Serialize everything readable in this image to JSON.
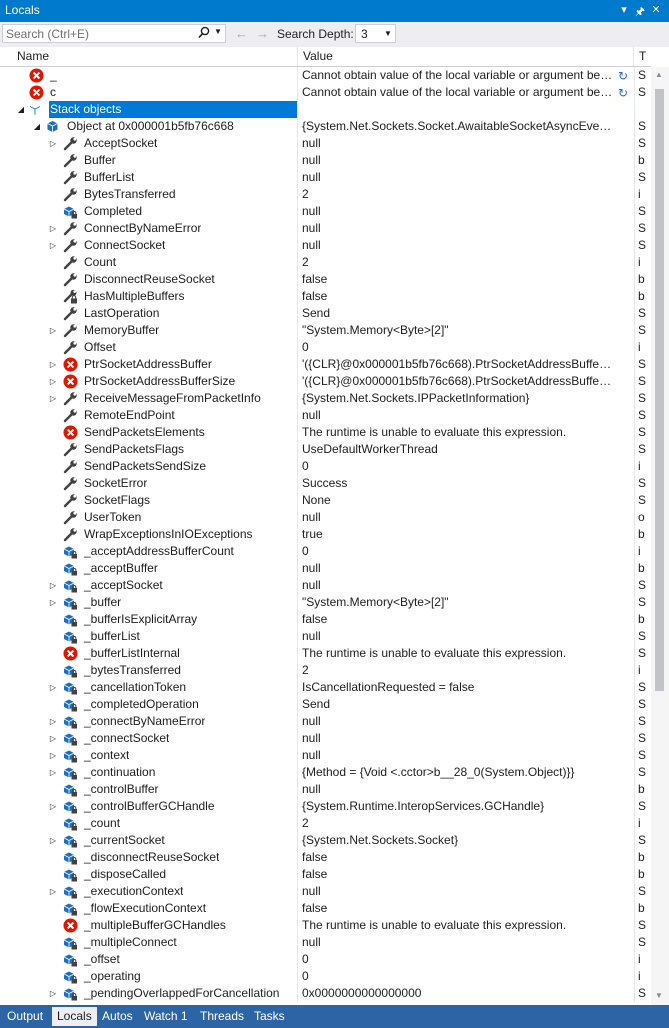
{
  "window": {
    "title": "Locals"
  },
  "toolbar": {
    "search_placeholder": "Search (Ctrl+E)",
    "search_depth_label": "Search Depth:",
    "search_depth_value": "3"
  },
  "columns": {
    "name": "Name",
    "value": "Value",
    "type": "T"
  },
  "rows": [
    {
      "name": "_",
      "value": "Cannot obtain value of the local variable or argument bec...",
      "type": "S",
      "icon": "error",
      "level": 1,
      "expander": "none",
      "refresh": true
    },
    {
      "name": "c",
      "value": "Cannot obtain value of the local variable or argument bec...",
      "type": "S",
      "icon": "error",
      "level": 1,
      "expander": "none",
      "refresh": true
    },
    {
      "name": "Stack objects",
      "value": "",
      "type": "",
      "icon": "stack",
      "level": 0,
      "expander": "expanded",
      "selected": true
    },
    {
      "name": "Object at 0x000001b5fb76c668",
      "value": "{System.Net.Sockets.Socket.AwaitableSocketAsyncEventArgs}",
      "type": "S",
      "icon": "object",
      "level": 1,
      "expander": "expanded"
    },
    {
      "name": "AcceptSocket",
      "value": "null",
      "type": "S",
      "icon": "wrench",
      "level": 2,
      "expander": "collapsed"
    },
    {
      "name": "Buffer",
      "value": "null",
      "type": "b",
      "icon": "wrench",
      "level": 2,
      "expander": "none"
    },
    {
      "name": "BufferList",
      "value": "null",
      "type": "S",
      "icon": "wrench",
      "level": 2,
      "expander": "none"
    },
    {
      "name": "BytesTransferred",
      "value": "2",
      "type": "i",
      "icon": "wrench",
      "level": 2,
      "expander": "none"
    },
    {
      "name": "Completed",
      "value": "null",
      "type": "S",
      "icon": "field-lock",
      "level": 2,
      "expander": "none"
    },
    {
      "name": "ConnectByNameError",
      "value": "null",
      "type": "S",
      "icon": "wrench",
      "level": 2,
      "expander": "collapsed"
    },
    {
      "name": "ConnectSocket",
      "value": "null",
      "type": "S",
      "icon": "wrench",
      "level": 2,
      "expander": "collapsed"
    },
    {
      "name": "Count",
      "value": "2",
      "type": "i",
      "icon": "wrench",
      "level": 2,
      "expander": "none"
    },
    {
      "name": "DisconnectReuseSocket",
      "value": "false",
      "type": "b",
      "icon": "wrench",
      "level": 2,
      "expander": "none"
    },
    {
      "name": "HasMultipleBuffers",
      "value": "false",
      "type": "b",
      "icon": "wrench-lock",
      "level": 2,
      "expander": "none"
    },
    {
      "name": "LastOperation",
      "value": "Send",
      "type": "S",
      "icon": "wrench",
      "level": 2,
      "expander": "none"
    },
    {
      "name": "MemoryBuffer",
      "value": "\"System.Memory<Byte>[2]\"",
      "type": "S",
      "icon": "wrench",
      "level": 2,
      "expander": "collapsed"
    },
    {
      "name": "Offset",
      "value": "0",
      "type": "i",
      "icon": "wrench",
      "level": 2,
      "expander": "none"
    },
    {
      "name": "PtrSocketAddressBuffer",
      "value": "'({CLR}@0x000001b5fb76c668).PtrSocketAddressBuffer' threw...",
      "type": "S",
      "icon": "error",
      "level": 2,
      "expander": "collapsed"
    },
    {
      "name": "PtrSocketAddressBufferSize",
      "value": "'({CLR}@0x000001b5fb76c668).PtrSocketAddressBufferSize' th...",
      "type": "S",
      "icon": "error",
      "level": 2,
      "expander": "collapsed"
    },
    {
      "name": "ReceiveMessageFromPacketInfo",
      "value": "{System.Net.Sockets.IPPacketInformation}",
      "type": "S",
      "icon": "wrench",
      "level": 2,
      "expander": "collapsed"
    },
    {
      "name": "RemoteEndPoint",
      "value": "null",
      "type": "S",
      "icon": "wrench",
      "level": 2,
      "expander": "none"
    },
    {
      "name": "SendPacketsElements",
      "value": "The runtime is unable to evaluate this expression.",
      "type": "S",
      "icon": "error",
      "level": 2,
      "expander": "none"
    },
    {
      "name": "SendPacketsFlags",
      "value": "UseDefaultWorkerThread",
      "type": "S",
      "icon": "wrench",
      "level": 2,
      "expander": "none"
    },
    {
      "name": "SendPacketsSendSize",
      "value": "0",
      "type": "i",
      "icon": "wrench",
      "level": 2,
      "expander": "none"
    },
    {
      "name": "SocketError",
      "value": "Success",
      "type": "S",
      "icon": "wrench",
      "level": 2,
      "expander": "none"
    },
    {
      "name": "SocketFlags",
      "value": "None",
      "type": "S",
      "icon": "wrench",
      "level": 2,
      "expander": "none"
    },
    {
      "name": "UserToken",
      "value": "null",
      "type": "o",
      "icon": "wrench",
      "level": 2,
      "expander": "none"
    },
    {
      "name": "WrapExceptionsInIOExceptions",
      "value": "true",
      "type": "b",
      "icon": "wrench",
      "level": 2,
      "expander": "none"
    },
    {
      "name": "_acceptAddressBufferCount",
      "value": "0",
      "type": "i",
      "icon": "field-lock",
      "level": 2,
      "expander": "none"
    },
    {
      "name": "_acceptBuffer",
      "value": "null",
      "type": "b",
      "icon": "field-lock",
      "level": 2,
      "expander": "none"
    },
    {
      "name": "_acceptSocket",
      "value": "null",
      "type": "S",
      "icon": "field-lock",
      "level": 2,
      "expander": "collapsed"
    },
    {
      "name": "_buffer",
      "value": "\"System.Memory<Byte>[2]\"",
      "type": "S",
      "icon": "field-lock",
      "level": 2,
      "expander": "collapsed"
    },
    {
      "name": "_bufferIsExplicitArray",
      "value": "false",
      "type": "b",
      "icon": "field-lock",
      "level": 2,
      "expander": "none"
    },
    {
      "name": "_bufferList",
      "value": "null",
      "type": "S",
      "icon": "field-lock",
      "level": 2,
      "expander": "none"
    },
    {
      "name": "_bufferListInternal",
      "value": "The runtime is unable to evaluate this expression.",
      "type": "S",
      "icon": "error",
      "level": 2,
      "expander": "none"
    },
    {
      "name": "_bytesTransferred",
      "value": "2",
      "type": "i",
      "icon": "field-lock",
      "level": 2,
      "expander": "none"
    },
    {
      "name": "_cancellationToken",
      "value": "IsCancellationRequested = false",
      "type": "S",
      "icon": "field-lock",
      "level": 2,
      "expander": "collapsed"
    },
    {
      "name": "_completedOperation",
      "value": "Send",
      "type": "S",
      "icon": "field-lock",
      "level": 2,
      "expander": "none"
    },
    {
      "name": "_connectByNameError",
      "value": "null",
      "type": "S",
      "icon": "field-lock",
      "level": 2,
      "expander": "collapsed"
    },
    {
      "name": "_connectSocket",
      "value": "null",
      "type": "S",
      "icon": "field-lock",
      "level": 2,
      "expander": "collapsed"
    },
    {
      "name": "_context",
      "value": "null",
      "type": "S",
      "icon": "field-lock",
      "level": 2,
      "expander": "collapsed"
    },
    {
      "name": "_continuation",
      "value": "{Method = {Void <.cctor>b__28_0(System.Object)}}",
      "type": "S",
      "icon": "field-lock",
      "level": 2,
      "expander": "collapsed"
    },
    {
      "name": "_controlBuffer",
      "value": "null",
      "type": "b",
      "icon": "field-lock",
      "level": 2,
      "expander": "none"
    },
    {
      "name": "_controlBufferGCHandle",
      "value": "{System.Runtime.InteropServices.GCHandle}",
      "type": "S",
      "icon": "field-lock",
      "level": 2,
      "expander": "collapsed"
    },
    {
      "name": "_count",
      "value": "2",
      "type": "i",
      "icon": "field-lock",
      "level": 2,
      "expander": "none"
    },
    {
      "name": "_currentSocket",
      "value": "{System.Net.Sockets.Socket}",
      "type": "S",
      "icon": "field-lock",
      "level": 2,
      "expander": "collapsed"
    },
    {
      "name": "_disconnectReuseSocket",
      "value": "false",
      "type": "b",
      "icon": "field-lock",
      "level": 2,
      "expander": "none"
    },
    {
      "name": "_disposeCalled",
      "value": "false",
      "type": "b",
      "icon": "field-lock",
      "level": 2,
      "expander": "none"
    },
    {
      "name": "_executionContext",
      "value": "null",
      "type": "S",
      "icon": "field-lock",
      "level": 2,
      "expander": "collapsed"
    },
    {
      "name": "_flowExecutionContext",
      "value": "false",
      "type": "b",
      "icon": "field-lock",
      "level": 2,
      "expander": "none"
    },
    {
      "name": "_multipleBufferGCHandles",
      "value": "The runtime is unable to evaluate this expression.",
      "type": "S",
      "icon": "error",
      "level": 2,
      "expander": "none"
    },
    {
      "name": "_multipleConnect",
      "value": "null",
      "type": "S",
      "icon": "field-lock",
      "level": 2,
      "expander": "none"
    },
    {
      "name": "_offset",
      "value": "0",
      "type": "i",
      "icon": "field-lock",
      "level": 2,
      "expander": "none"
    },
    {
      "name": "_operating",
      "value": "0",
      "type": "i",
      "icon": "field-lock",
      "level": 2,
      "expander": "none"
    },
    {
      "name": "_pendingOverlappedForCancellation",
      "value": "0x0000000000000000",
      "type": "S",
      "icon": "field-lock",
      "level": 2,
      "expander": "collapsed"
    }
  ],
  "tabs": [
    {
      "label": "Output",
      "active": false
    },
    {
      "label": "Locals",
      "active": true
    },
    {
      "label": "Autos",
      "active": false
    },
    {
      "label": "Watch 1",
      "active": false
    },
    {
      "label": "Threads",
      "active": false
    },
    {
      "label": "Tasks",
      "active": false
    }
  ],
  "colors": {
    "accent": "#007acc",
    "selection": "#0078d7",
    "error": "#e51400",
    "icon_dark": "#424242",
    "field_blue": "#1e6fbf",
    "tab_strip": "#2d64a6"
  }
}
